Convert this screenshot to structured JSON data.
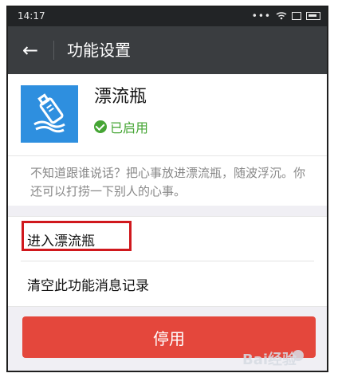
{
  "statusbar": {
    "time": "14:17",
    "signal_dots": "•••",
    "wifi_icon": "wifi-icon",
    "box_icon": "square-icon",
    "battery_icon": "battery-icon"
  },
  "titlebar": {
    "back_icon": "arrow-left-icon",
    "title": "功能设置"
  },
  "app": {
    "name": "漂流瓶",
    "status": "已启用",
    "icon": "bottle-icon",
    "colors": {
      "icon_bg": "#2e8fdf",
      "status": "#45a534"
    }
  },
  "description": {
    "text": "不知道跟谁说话？把心事放进漂流瓶，随波浮沉。你还可以打捞一下别人的心事。"
  },
  "menu": {
    "items": [
      {
        "label": "进入漂流瓶"
      },
      {
        "label": "清空此功能消息记录"
      }
    ]
  },
  "actions": {
    "disable_label": "停用"
  },
  "watermark": {
    "text": "Bai经验"
  }
}
